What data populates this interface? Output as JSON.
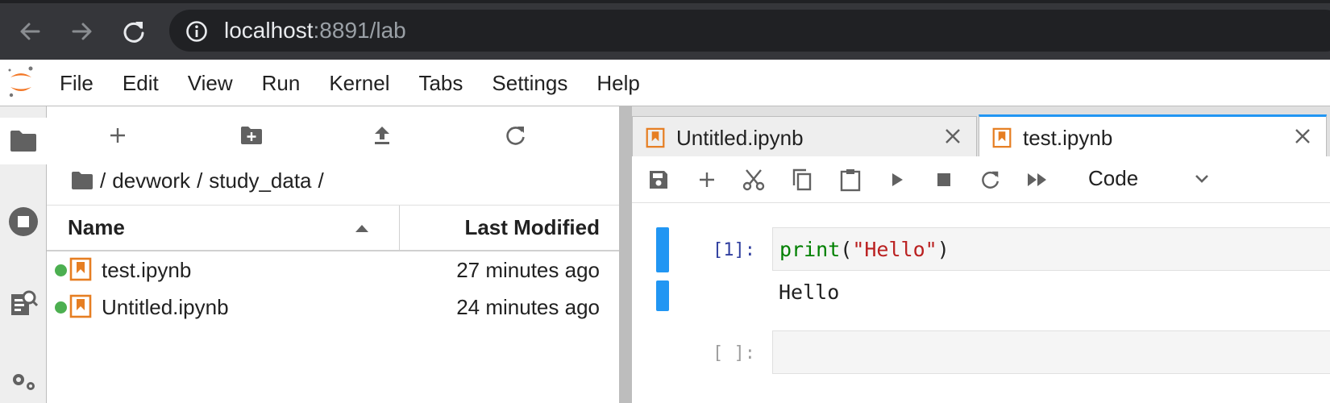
{
  "browser": {
    "url_host": "localhost",
    "url_rest": ":8891/lab"
  },
  "menubar": {
    "items": [
      "File",
      "Edit",
      "View",
      "Run",
      "Kernel",
      "Tabs",
      "Settings",
      "Help"
    ]
  },
  "filebrowser": {
    "breadcrumb": [
      "devwork",
      "study_data"
    ],
    "columns": {
      "name": "Name",
      "modified": "Last Modified"
    },
    "files": [
      {
        "name": "test.ipynb",
        "modified": "27 minutes ago",
        "running": true
      },
      {
        "name": "Untitled.ipynb",
        "modified": "24 minutes ago",
        "running": true
      }
    ]
  },
  "tabs": [
    {
      "label": "Untitled.ipynb",
      "active": false
    },
    {
      "label": "test.ipynb",
      "active": true
    }
  ],
  "notebook": {
    "cell_type": "Code",
    "cells": [
      {
        "prompt": "[1]:",
        "code_fn": "print",
        "code_open": "(",
        "code_str": "\"Hello\"",
        "code_close": ")",
        "output": "Hello"
      },
      {
        "prompt": "[ ]:",
        "code": ""
      }
    ]
  },
  "colors": {
    "accent": "#2196f3",
    "notebook_icon": "#e67e22",
    "running_dot": "#4caf50"
  },
  "icons": {
    "browser": [
      "back-arrow-icon",
      "forward-arrow-icon",
      "reload-icon",
      "info-icon"
    ],
    "activity": [
      "folder-icon",
      "stop-circle-icon",
      "property-inspector-icon",
      "extension-icon"
    ],
    "filebrowser_toolbar": [
      "new-launcher-icon",
      "new-folder-icon",
      "upload-icon",
      "refresh-icon"
    ],
    "notebook_toolbar": [
      "save-icon",
      "insert-cell-icon",
      "cut-icon",
      "copy-icon",
      "paste-icon",
      "run-icon",
      "stop-icon",
      "restart-icon",
      "restart-run-all-icon"
    ]
  }
}
